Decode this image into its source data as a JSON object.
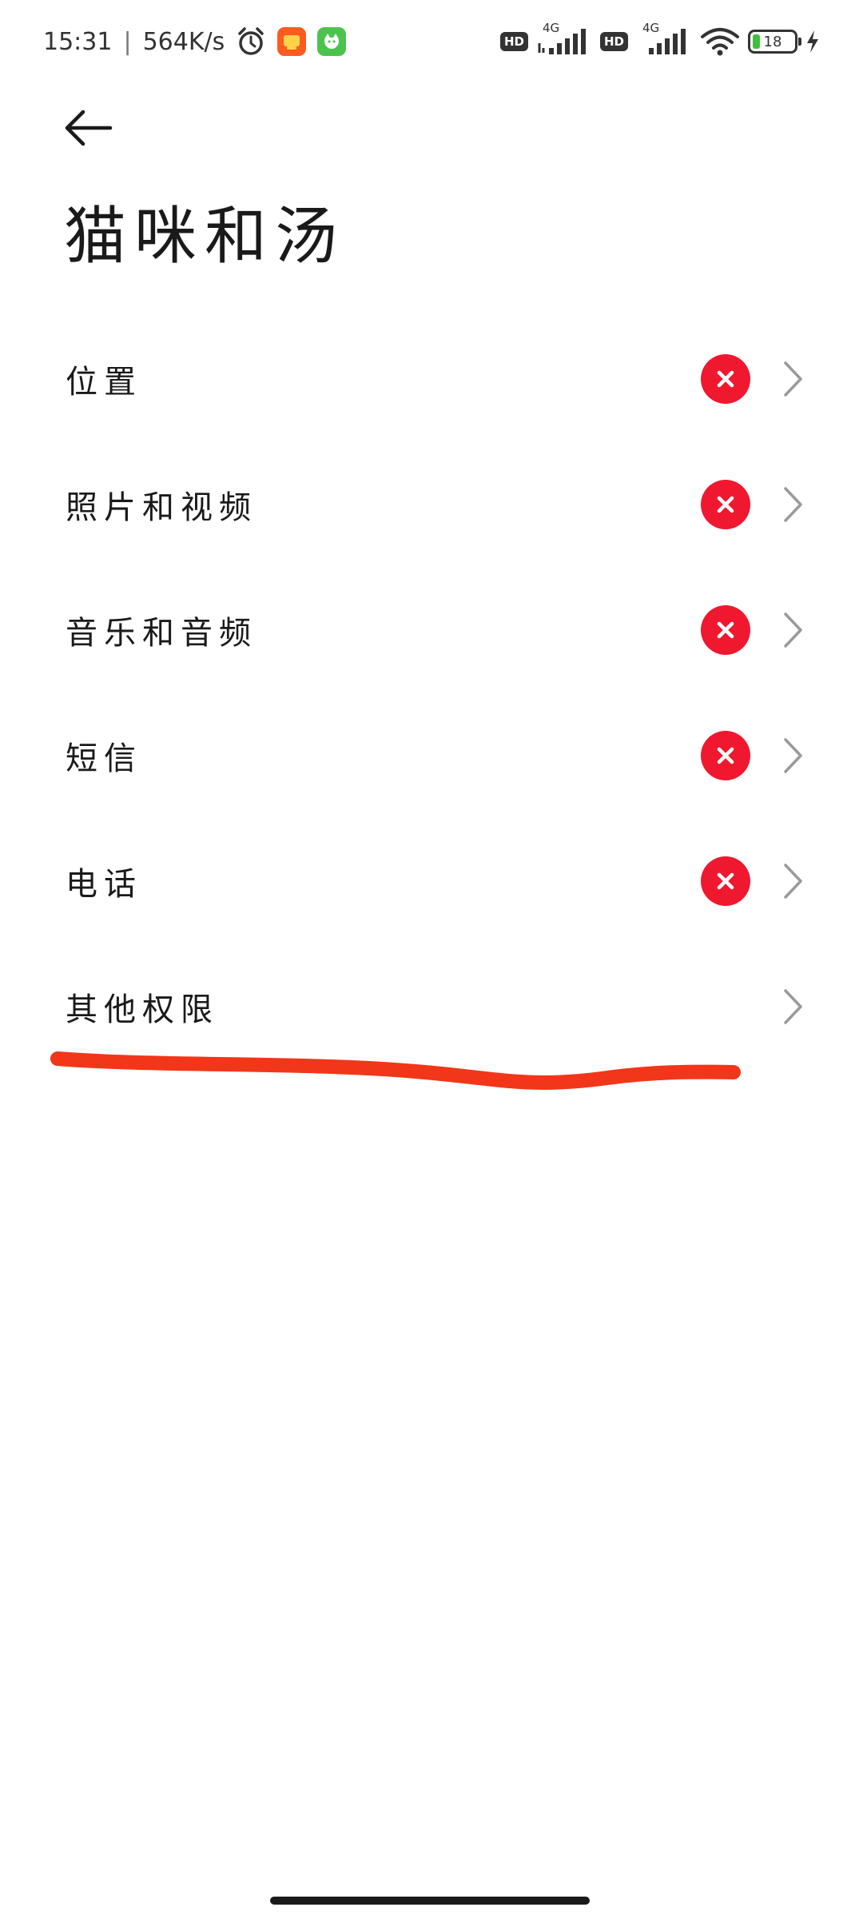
{
  "status_bar": {
    "time": "15:31",
    "separator": "|",
    "net_speed": "564K/s",
    "hd_label_1": "HD",
    "hd_label_2": "HD",
    "signal_label_1": "4G",
    "signal_label_2": "4G",
    "battery_level": "18",
    "icons": [
      "alarm-icon",
      "taobao-app-icon",
      "cat-app-icon",
      "signal-icon",
      "wifi-icon",
      "battery-icon",
      "charging-icon"
    ]
  },
  "header": {
    "title": "猫咪和汤",
    "back_icon": "back-arrow-icon"
  },
  "permissions": [
    {
      "label": "位置",
      "status": "denied"
    },
    {
      "label": "照片和视频",
      "status": "denied"
    },
    {
      "label": "音乐和音频",
      "status": "denied"
    },
    {
      "label": "短信",
      "status": "denied"
    },
    {
      "label": "电话",
      "status": "denied"
    },
    {
      "label": "其他权限",
      "status": "none"
    }
  ],
  "colors": {
    "denied": "#f0182f",
    "annotation": "#f2361a",
    "chevron": "#9a9a9a",
    "text": "#1a1a1a"
  }
}
